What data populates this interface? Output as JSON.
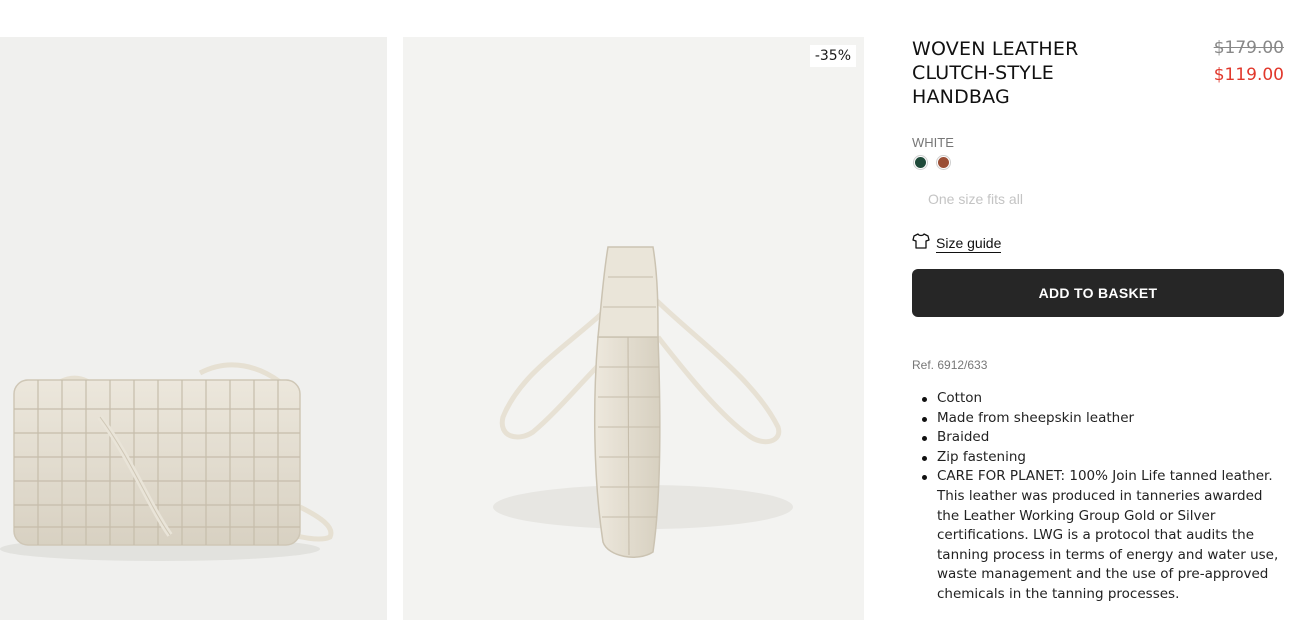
{
  "gallery": {
    "discount_badge": "-35%"
  },
  "product": {
    "title": "WOVEN LEATHER CLUTCH-STYLE HANDBAG",
    "price_original": "$179.00",
    "price_sale": "$119.00",
    "price_sale_color": "#e1382c",
    "color_label": "WHITE",
    "swatches": [
      {
        "name": "green",
        "color": "#1f4a3a"
      },
      {
        "name": "brown",
        "color": "#9b4f36"
      }
    ],
    "size_text": "One size fits all",
    "size_guide_label": "Size guide",
    "size_guide_icon": "tshirt-icon",
    "add_to_basket_label": "ADD TO BASKET",
    "button_color": "#262626",
    "reference": "Ref. 6912/633",
    "features": [
      "Cotton",
      "Made from sheepskin leather",
      "Braided",
      "Zip fastening",
      "CARE FOR PLANET: 100% Join Life tanned leather. This leather was produced in tanneries awarded the Leather Working Group Gold or Silver certifications. LWG is a protocol that audits the tanning process in terms of energy and water use, waste management and the use of pre-approved chemicals in the tanning processes."
    ]
  }
}
